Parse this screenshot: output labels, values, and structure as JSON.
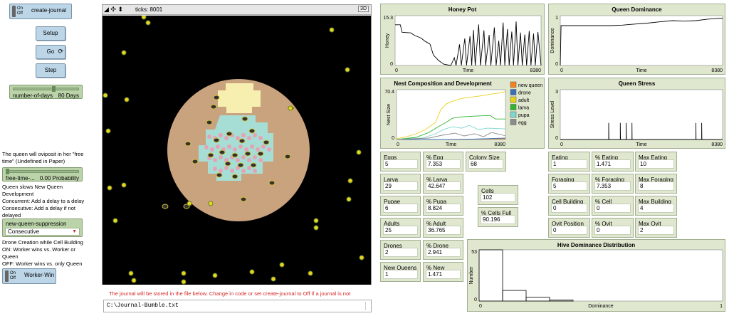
{
  "switches": {
    "create_journal": {
      "on": "On",
      "off": "Off",
      "label": "create-journal"
    },
    "worker_win": {
      "on": "On",
      "off": "Off",
      "label": "Worker-Win"
    }
  },
  "buttons": {
    "setup": "Setup",
    "go": "Go",
    "step": "Step"
  },
  "number_of_days": {
    "label": "number-of-days",
    "value": "80 Days",
    "fraction": 0.58
  },
  "notes": {
    "oviposit": "The queen will oviposit in her \"free time\" (Undefined in Paper)",
    "slows": "Queen slows New Queen Development\nConcurrent: Add a delay to a delay\nConsecutive: Add a delay if not delayed",
    "drone": "Drone Creation while Cell Building\nON:  Worker wins vs. Worker or Queen\nOFF: Worker wins vs. only Queen"
  },
  "free_time": {
    "label": "free-time-...",
    "value": "0.00 Probability",
    "fraction": 0.0
  },
  "suppression": {
    "label": "new-queen-suppression",
    "value": "Consecutive"
  },
  "view": {
    "ticks": "ticks: 8001",
    "three_d": "3D"
  },
  "journal": {
    "notice": "The journal will be stored in the file below. Change in code or set create-journal to Off if a journal is not",
    "path": "C:\\Journal-Bumble.txt"
  },
  "monitors": {
    "eggs": {
      "label": "Eggs",
      "value": "5"
    },
    "pct_egg": {
      "label": "% Egg",
      "value": "7.353"
    },
    "colony_size": {
      "label": "Colony Size",
      "value": "68"
    },
    "larva": {
      "label": "Larva",
      "value": "29"
    },
    "pct_larva": {
      "label": "% Larva",
      "value": "42.647"
    },
    "pupae": {
      "label": "Pupae",
      "value": "6"
    },
    "pct_pupa": {
      "label": "% Pupa",
      "value": "8.824"
    },
    "adults": {
      "label": "Adults",
      "value": "25"
    },
    "pct_adult": {
      "label": "% Adult",
      "value": "36.765"
    },
    "drones": {
      "label": "Drones",
      "value": "2"
    },
    "pct_drone": {
      "label": "% Drone",
      "value": "2.941"
    },
    "new_queens": {
      "label": "New Queens",
      "value": "1"
    },
    "pct_new_queen": {
      "label": "% New Queen",
      "value": "1.471"
    },
    "cells": {
      "label": "Cells",
      "value": "102"
    },
    "pct_cells_full": {
      "label": "% Cells Full",
      "value": "90.196"
    },
    "eating": {
      "label": "Eating",
      "value": "1"
    },
    "pct_eating": {
      "label": "% Eating",
      "value": "1.471"
    },
    "max_eating": {
      "label": "Max Eating",
      "value": "10"
    },
    "foraging": {
      "label": "Foraging",
      "value": "5"
    },
    "pct_foraging": {
      "label": "% Foraging",
      "value": "7.353"
    },
    "max_foraging": {
      "label": "Max Foraging",
      "value": "8"
    },
    "cell_building": {
      "label": "Cell Building",
      "value": "0"
    },
    "pct_cell_building": {
      "label": "% Cell Building",
      "value": "0"
    },
    "max_building": {
      "label": "Max Building",
      "value": "4"
    },
    "ovit_position": {
      "label": "Ovit Position",
      "value": "0"
    },
    "pct_ovit_position": {
      "label": "% Ovit Position",
      "value": "0"
    },
    "max_ovit": {
      "label": "Max Ovit",
      "value": "2"
    }
  },
  "colors": {
    "new_queen": "#f58220",
    "drone": "#3a6fb7",
    "adult": "#e8d21c",
    "larva": "#2fb62f",
    "pupa": "#7ed8d0",
    "egg": "#8c8c8c",
    "black_line": "#000000"
  },
  "chart_data": [
    {
      "type": "line",
      "title": "Honey Pot",
      "xlabel": "Time",
      "ylabel": "Honey",
      "xlim": [
        0,
        8380
      ],
      "ylim": [
        0,
        15.3
      ],
      "ticks": {
        "x0": "0",
        "x1": "8380",
        "y0": "0",
        "y1": "15.3"
      },
      "series": [
        {
          "values": [
            [
              0,
              12.5
            ],
            [
              300,
              12.5
            ],
            [
              400,
              10.2
            ],
            [
              900,
              10
            ],
            [
              1100,
              9.3
            ],
            [
              1500,
              8.4
            ],
            [
              1700,
              7.5
            ],
            [
              2000,
              6.6
            ],
            [
              2200,
              3.2
            ],
            [
              2500,
              1.5
            ],
            [
              2800,
              0.4
            ],
            [
              3200,
              0
            ],
            [
              3400,
              2.4
            ],
            [
              3500,
              0
            ],
            [
              3700,
              6.5
            ],
            [
              3800,
              0
            ],
            [
              4000,
              8.3
            ],
            [
              4100,
              0
            ],
            [
              4300,
              9
            ],
            [
              4400,
              0
            ],
            [
              4500,
              10.9
            ],
            [
              4600,
              0
            ],
            [
              4800,
              12.6
            ],
            [
              4900,
              0
            ],
            [
              5100,
              10.8
            ],
            [
              5200,
              0
            ],
            [
              5400,
              9.4
            ],
            [
              5500,
              0
            ],
            [
              5700,
              11.7
            ],
            [
              5800,
              0
            ],
            [
              5950,
              7.6
            ],
            [
              6050,
              0
            ],
            [
              6200,
              13.2
            ],
            [
              6300,
              0
            ],
            [
              6450,
              11.2
            ],
            [
              6550,
              0
            ],
            [
              6700,
              10.4
            ],
            [
              6800,
              0
            ],
            [
              6950,
              13.5
            ],
            [
              7050,
              0
            ],
            [
              7200,
              10.1
            ],
            [
              7300,
              0
            ],
            [
              7450,
              9.5
            ],
            [
              7550,
              0
            ],
            [
              7700,
              10.6
            ],
            [
              7800,
              0
            ],
            [
              7950,
              9.8
            ],
            [
              8050,
              0
            ],
            [
              8200,
              10.3
            ],
            [
              8380,
              0
            ]
          ]
        }
      ]
    },
    {
      "type": "line",
      "title": "Queen Dominance",
      "xlabel": "Time",
      "ylabel": "Dominance",
      "xlim": [
        0,
        8380
      ],
      "ylim": [
        0,
        1
      ],
      "ticks": {
        "x0": "0",
        "x1": "8380",
        "y0": "0",
        "y1": "1"
      },
      "series": [
        {
          "values": [
            [
              0,
              0
            ],
            [
              40,
              0.8
            ],
            [
              1000,
              0.8
            ],
            [
              2000,
              0.8
            ],
            [
              2600,
              0.8
            ],
            [
              3200,
              0.81
            ],
            [
              3800,
              0.83
            ],
            [
              4500,
              0.85
            ],
            [
              5200,
              0.88
            ],
            [
              5800,
              0.9
            ],
            [
              6400,
              0.89
            ],
            [
              7000,
              0.9
            ],
            [
              7600,
              0.93
            ],
            [
              8000,
              0.94
            ],
            [
              8380,
              0.95
            ]
          ]
        }
      ]
    },
    {
      "type": "line",
      "title": "Nest Composition and Development",
      "xlabel": "Time",
      "ylabel": "Nest Size",
      "xlim": [
        0,
        8380
      ],
      "ylim": [
        0,
        70.4
      ],
      "ticks": {
        "x0": "0",
        "x1": "8380",
        "y0": "0",
        "y1": "70.4"
      },
      "series": [
        {
          "name": "new queen",
          "values": [
            [
              0,
              0
            ],
            [
              3500,
              0
            ],
            [
              8380,
              1
            ]
          ]
        },
        {
          "name": "drone",
          "values": [
            [
              0,
              0
            ],
            [
              5000,
              0
            ],
            [
              8380,
              2
            ]
          ]
        },
        {
          "name": "adult",
          "values": [
            [
              0,
              1
            ],
            [
              800,
              4
            ],
            [
              1500,
              8
            ],
            [
              2200,
              14
            ],
            [
              3000,
              24
            ],
            [
              3400,
              42
            ],
            [
              3800,
              50
            ],
            [
              4300,
              54
            ],
            [
              5000,
              58
            ],
            [
              5800,
              60
            ],
            [
              6600,
              62
            ],
            [
              7200,
              64
            ],
            [
              8000,
              66
            ],
            [
              8380,
              68
            ]
          ]
        },
        {
          "name": "larva",
          "values": [
            [
              0,
              0
            ],
            [
              1500,
              3
            ],
            [
              2500,
              10
            ],
            [
              3200,
              18
            ],
            [
              3800,
              24
            ],
            [
              4300,
              30
            ],
            [
              5000,
              32
            ],
            [
              6000,
              33
            ],
            [
              7200,
              34
            ],
            [
              7600,
              29
            ],
            [
              8380,
              29
            ]
          ]
        },
        {
          "name": "pupa",
          "values": [
            [
              0,
              0
            ],
            [
              2000,
              2
            ],
            [
              3000,
              8
            ],
            [
              3600,
              14
            ],
            [
              4300,
              18
            ],
            [
              5000,
              16
            ],
            [
              5600,
              20
            ],
            [
              6300,
              14
            ],
            [
              7000,
              16
            ],
            [
              8380,
              15
            ]
          ]
        },
        {
          "name": "egg",
          "values": [
            [
              0,
              0
            ],
            [
              2500,
              2
            ],
            [
              3500,
              6
            ],
            [
              4500,
              9
            ],
            [
              5200,
              5
            ],
            [
              6000,
              8
            ],
            [
              6700,
              4
            ],
            [
              7300,
              10
            ],
            [
              8000,
              7
            ],
            [
              8380,
              5
            ]
          ]
        }
      ]
    },
    {
      "type": "line",
      "title": "Queen Stress",
      "xlabel": "Time",
      "ylabel": "Stress Level",
      "xlim": [
        0,
        8380
      ],
      "ylim": [
        0,
        3
      ],
      "ticks": {
        "x0": "0",
        "x1": "8380",
        "y0": "0",
        "y1": "3"
      },
      "series": [
        {
          "values": [
            [
              0,
              0
            ],
            [
              2500,
              0
            ],
            [
              2500,
              1
            ],
            [
              2510,
              0
            ],
            [
              3100,
              0
            ],
            [
              3100,
              1
            ],
            [
              3110,
              0
            ],
            [
              3400,
              0
            ],
            [
              3400,
              1
            ],
            [
              3410,
              0
            ],
            [
              3700,
              0
            ],
            [
              3700,
              1
            ],
            [
              3710,
              0
            ],
            [
              7000,
              0
            ],
            [
              7000,
              1
            ],
            [
              7010,
              0
            ],
            [
              7300,
              0
            ],
            [
              7300,
              1
            ],
            [
              7310,
              0
            ],
            [
              8380,
              0
            ]
          ]
        }
      ]
    },
    {
      "type": "bar",
      "title": "Hive Dominance Distribution",
      "xlabel": "Dominance",
      "ylabel": "Number",
      "ylim": [
        0,
        53
      ],
      "ticks": {
        "x0": "0",
        "x1": "1",
        "y0": "0",
        "y1": "53"
      },
      "categories": [
        "0-0.1",
        "0.1-0.2",
        "0.2-0.3",
        "0.3-0.4"
      ],
      "values": [
        53,
        11,
        4,
        1
      ]
    }
  ]
}
